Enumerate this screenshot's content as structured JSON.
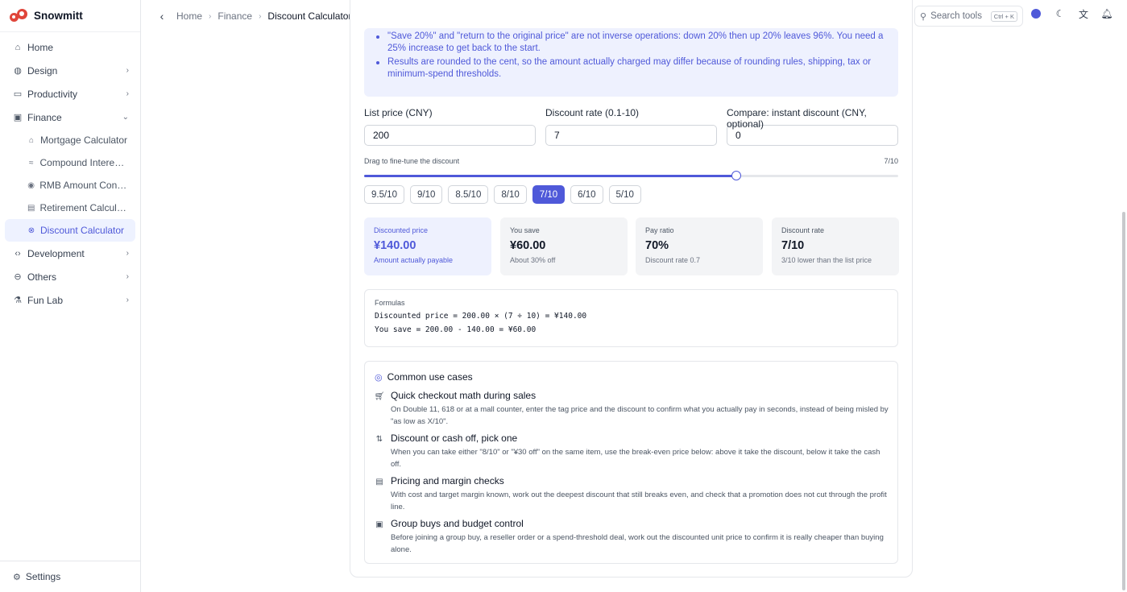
{
  "brand": {
    "name": "Snowmitt"
  },
  "sidebar": {
    "items": [
      {
        "label": "Home",
        "icon": "home-icon"
      },
      {
        "label": "Design",
        "icon": "palette-icon"
      },
      {
        "label": "Productivity",
        "icon": "briefcase-icon"
      },
      {
        "label": "Finance",
        "icon": "wallet-icon"
      },
      {
        "label": "Development",
        "icon": "code-icon"
      },
      {
        "label": "Others",
        "icon": "more-icon"
      },
      {
        "label": "Fun Lab",
        "icon": "flask-icon"
      }
    ],
    "finance_sub": [
      {
        "label": "Mortgage Calculator",
        "icon": "house-icon"
      },
      {
        "label": "Compound Interest ...",
        "icon": "growth-icon"
      },
      {
        "label": "RMB Amount Conve...",
        "icon": "coin-icon"
      },
      {
        "label": "Retirement Calculator",
        "icon": "calendar-icon"
      },
      {
        "label": "Discount Calculator",
        "icon": "discount-icon"
      }
    ],
    "settings_label": "Settings"
  },
  "topbar": {
    "breadcrumb": [
      "Home",
      "Finance",
      "Discount Calculator"
    ],
    "search_placeholder": "Search tools",
    "search_shortcut": "Ctrl + K",
    "accent": "#4f59d9"
  },
  "notes": [
    "\"Save 20%\" and \"return to the original price\" are not inverse operations: down 20% then up 20% leaves 96%. You need a 25% increase to get back to the start.",
    "Results are rounded to the cent, so the amount actually charged may differ because of rounding rules, shipping, tax or minimum-spend thresholds."
  ],
  "inputs": {
    "list_price": {
      "label": "List price (CNY)",
      "value": "200"
    },
    "discount_rate": {
      "label": "Discount rate (0.1-10)",
      "value": "7"
    },
    "instant_discount": {
      "label": "Compare: instant discount (CNY, optional)",
      "value": "0"
    }
  },
  "slider": {
    "label": "Drag to fine-tune the discount",
    "value_label": "7/10",
    "value": 7,
    "min": 0.1,
    "max": 10
  },
  "presets": [
    "9.5/10",
    "9/10",
    "8.5/10",
    "8/10",
    "7/10",
    "6/10",
    "5/10"
  ],
  "preset_active": "7/10",
  "stats": [
    {
      "title": "Discounted price",
      "value": "¥140.00",
      "sub": "Amount actually payable"
    },
    {
      "title": "You save",
      "value": "¥60.00",
      "sub": "About 30% off"
    },
    {
      "title": "Pay ratio",
      "value": "70%",
      "sub": "Discount rate 0.7"
    },
    {
      "title": "Discount rate",
      "value": "7/10",
      "sub": "3/10 lower than the list price"
    }
  ],
  "formulas": {
    "title": "Formulas",
    "lines": [
      "Discounted price = 200.00 × (7 ÷ 10) = ¥140.00",
      "You save = 200.00 - 140.00 = ¥60.00"
    ]
  },
  "use_cases": {
    "title": "Common use cases",
    "items": [
      {
        "icon": "cart-icon",
        "title": "Quick checkout math during sales",
        "desc": "On Double 11, 618 or at a mall counter, enter the tag price and the discount to confirm what you actually pay in seconds, instead of being misled by \"as low as X/10\"."
      },
      {
        "icon": "swap-icon",
        "title": "Discount or cash off, pick one",
        "desc": "When you can take either \"8/10\" or \"¥30 off\" on the same item, use the break-even price below: above it take the discount, below it take the cash off."
      },
      {
        "icon": "card-icon",
        "title": "Pricing and margin checks",
        "desc": "With cost and target margin known, work out the deepest discount that still breaks even, and check that a promotion does not cut through the profit line."
      },
      {
        "icon": "wallet-icon",
        "title": "Group buys and budget control",
        "desc": "Before joining a group buy, a reseller order or a spend-threshold deal, work out the discounted unit price to confirm it is really cheaper than buying alone."
      }
    ]
  }
}
